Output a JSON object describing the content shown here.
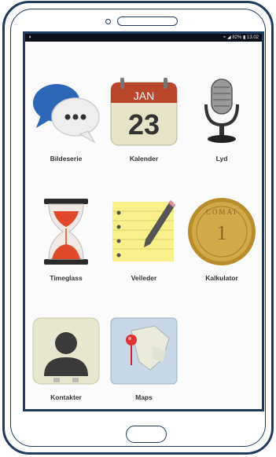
{
  "statusbar": {
    "battery": "82%",
    "time": "13.02"
  },
  "apps": [
    {
      "label": "Bildeserie",
      "icon": "chat-bubbles-icon"
    },
    {
      "label": "Kalender",
      "icon": "calendar-icon",
      "month": "JAN",
      "day": "23"
    },
    {
      "label": "Lyd",
      "icon": "microphone-icon"
    },
    {
      "label": "Timeglass",
      "icon": "hourglass-icon"
    },
    {
      "label": "Veileder",
      "icon": "notepad-pencil-icon"
    },
    {
      "label": "Kalkulator",
      "icon": "coin-icon",
      "coin_text": "COMAI",
      "coin_number": "1"
    },
    {
      "label": "Kontakter",
      "icon": "contact-person-icon"
    },
    {
      "label": "Maps",
      "icon": "map-pin-icon"
    }
  ]
}
